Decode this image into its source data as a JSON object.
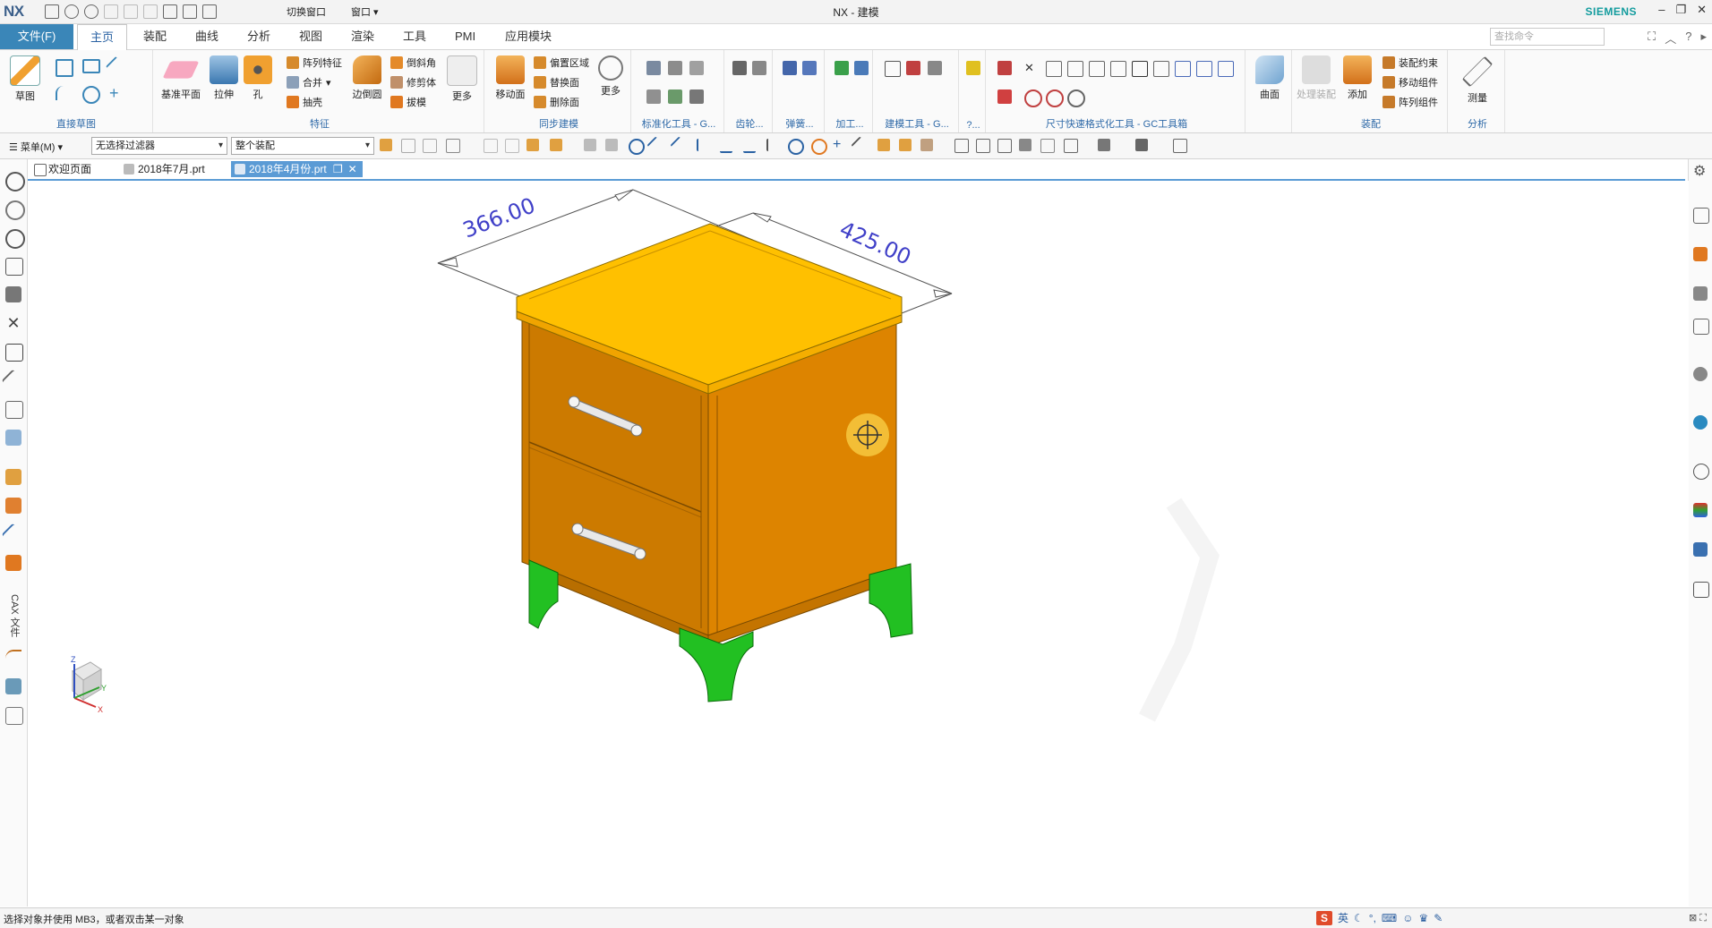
{
  "app": {
    "logo": "NX",
    "title": "NX - 建模",
    "brand": "SIEMENS",
    "switch_window": "切换窗口",
    "window_menu": "窗口"
  },
  "tabs": {
    "file": "文件(F)",
    "items": [
      "主页",
      "装配",
      "曲线",
      "分析",
      "视图",
      "渲染",
      "工具",
      "PMI",
      "应用模块"
    ],
    "active": "主页",
    "search_placeholder": "查找命令"
  },
  "ribbon": {
    "sketch": {
      "label": "草图",
      "group": "直接草图"
    },
    "feature": {
      "datum_plane": "基准平面",
      "extrude": "拉伸",
      "hole": "孔",
      "pattern_feature": "阵列特征",
      "unite": "合并",
      "shell": "抽壳",
      "edge_blend": "边倒圆",
      "chamfer": "倒斜角",
      "trim_body": "修剪体",
      "draft": "拔模",
      "more": "更多",
      "group": "特征"
    },
    "sync": {
      "move_face": "移动面",
      "offset_region": "偏置区域",
      "replace_face": "替换面",
      "delete_face": "删除面",
      "more": "更多",
      "group": "同步建模"
    },
    "groups_mid": [
      "标准化工具 - G...",
      "齿轮...",
      "弹簧...",
      "加工...",
      "建模工具 - G...",
      "?..."
    ],
    "gc_group": "尺寸快速格式化工具 - GC工具箱",
    "surface": {
      "label": "曲面"
    },
    "assembly": {
      "weld": "处理装配",
      "add": "添加",
      "constraint": "装配约束",
      "move_component": "移动组件",
      "pattern_component": "阵列组件",
      "group": "装配"
    },
    "analysis": {
      "measure": "测量",
      "group": "分析"
    }
  },
  "toolbar": {
    "menu": "菜单(M)",
    "filter": "无选择过滤器",
    "scope": "整个装配"
  },
  "doc_tabs": [
    {
      "label": "欢迎页面",
      "active": false
    },
    {
      "label": "2018年7月.prt",
      "active": false
    },
    {
      "label": "2018年4月份.prt",
      "active": true
    }
  ],
  "leftbar": {
    "vertical_label": "CAX 文件"
  },
  "canvas": {
    "dim1": "366.00",
    "dim2": "425.00"
  },
  "statusbar": {
    "message": "选择对象并使用 MB3，或者双击某一对象",
    "ime": "英"
  },
  "colors": {
    "accent": "#3a86b8",
    "cabinet": "#e08a00",
    "top": "#ffc000",
    "legs": "#22c022"
  }
}
